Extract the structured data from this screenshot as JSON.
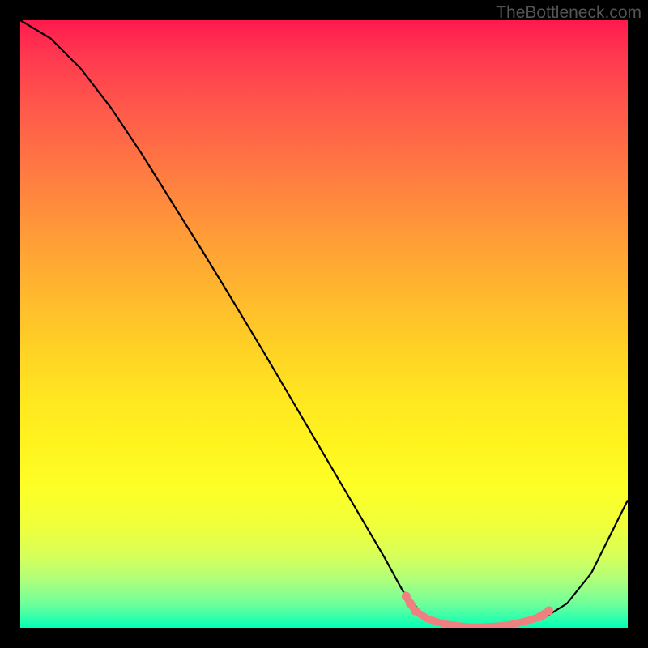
{
  "watermark": "TheBottleneck.com",
  "chart_data": {
    "type": "line",
    "title": "",
    "xlabel": "",
    "ylabel": "",
    "xlim": [
      0,
      100
    ],
    "ylim": [
      0,
      100
    ],
    "series": [
      {
        "name": "bottleneck-curve",
        "x": [
          0,
          5,
          10,
          15,
          20,
          25,
          30,
          35,
          40,
          45,
          50,
          55,
          60,
          63,
          66,
          70,
          74,
          78,
          82,
          86,
          90,
          94,
          100
        ],
        "y": [
          100,
          97,
          92,
          85.5,
          78,
          70,
          62,
          53.8,
          45.5,
          37,
          28.5,
          20,
          11.5,
          6,
          2.5,
          0.5,
          0,
          0,
          0.5,
          1.5,
          4,
          9,
          21
        ]
      }
    ],
    "markers": {
      "name": "highlight-dots",
      "color": "#f08080",
      "points": [
        {
          "x": 63.5,
          "y": 5.2
        },
        {
          "x": 64.2,
          "y": 4.0
        },
        {
          "x": 65.0,
          "y": 2.8
        },
        {
          "x": 67.0,
          "y": 1.5
        },
        {
          "x": 68.5,
          "y": 1.0
        },
        {
          "x": 70.0,
          "y": 0.6
        },
        {
          "x": 71.5,
          "y": 0.4
        },
        {
          "x": 73.0,
          "y": 0.2
        },
        {
          "x": 74.5,
          "y": 0.1
        },
        {
          "x": 76.0,
          "y": 0.1
        },
        {
          "x": 77.5,
          "y": 0.2
        },
        {
          "x": 79.0,
          "y": 0.3
        },
        {
          "x": 80.5,
          "y": 0.5
        },
        {
          "x": 82.0,
          "y": 0.8
        },
        {
          "x": 84.0,
          "y": 1.3
        },
        {
          "x": 85.5,
          "y": 1.8
        },
        {
          "x": 86.2,
          "y": 2.2
        },
        {
          "x": 87.0,
          "y": 2.8
        }
      ]
    },
    "gradient_stops": [
      {
        "pos": 0,
        "color": "#ff1a4d"
      },
      {
        "pos": 50,
        "color": "#ffd424"
      },
      {
        "pos": 100,
        "color": "#00ffb8"
      }
    ]
  }
}
